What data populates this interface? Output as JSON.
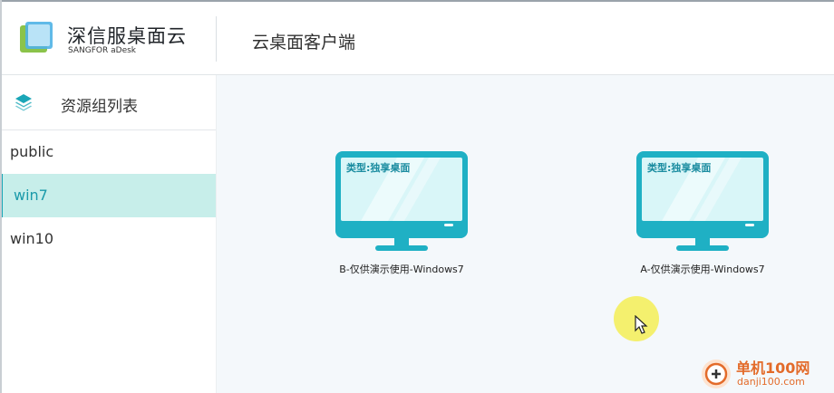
{
  "header": {
    "brand_name": "深信服桌面云",
    "brand_sub": "SANGFOR aDesk",
    "app_title": "云桌面客户端"
  },
  "sidebar": {
    "heading": "资源组列表",
    "groups": [
      {
        "label": "public",
        "active": false
      },
      {
        "label": "win7",
        "active": true
      },
      {
        "label": "win10",
        "active": false
      }
    ]
  },
  "desktops": [
    {
      "type_label": "类型:独享桌面",
      "name": "B-仅供演示使用-Windows7"
    },
    {
      "type_label": "类型:独享桌面",
      "name": "A-仅供演示使用-Windows7"
    }
  ],
  "watermark": {
    "line1": "单机100网",
    "line2": "danji100.com"
  },
  "colors": {
    "accent": "#1aa6b7",
    "active_bg": "#c7eeea",
    "main_bg": "#f4f8fb"
  }
}
